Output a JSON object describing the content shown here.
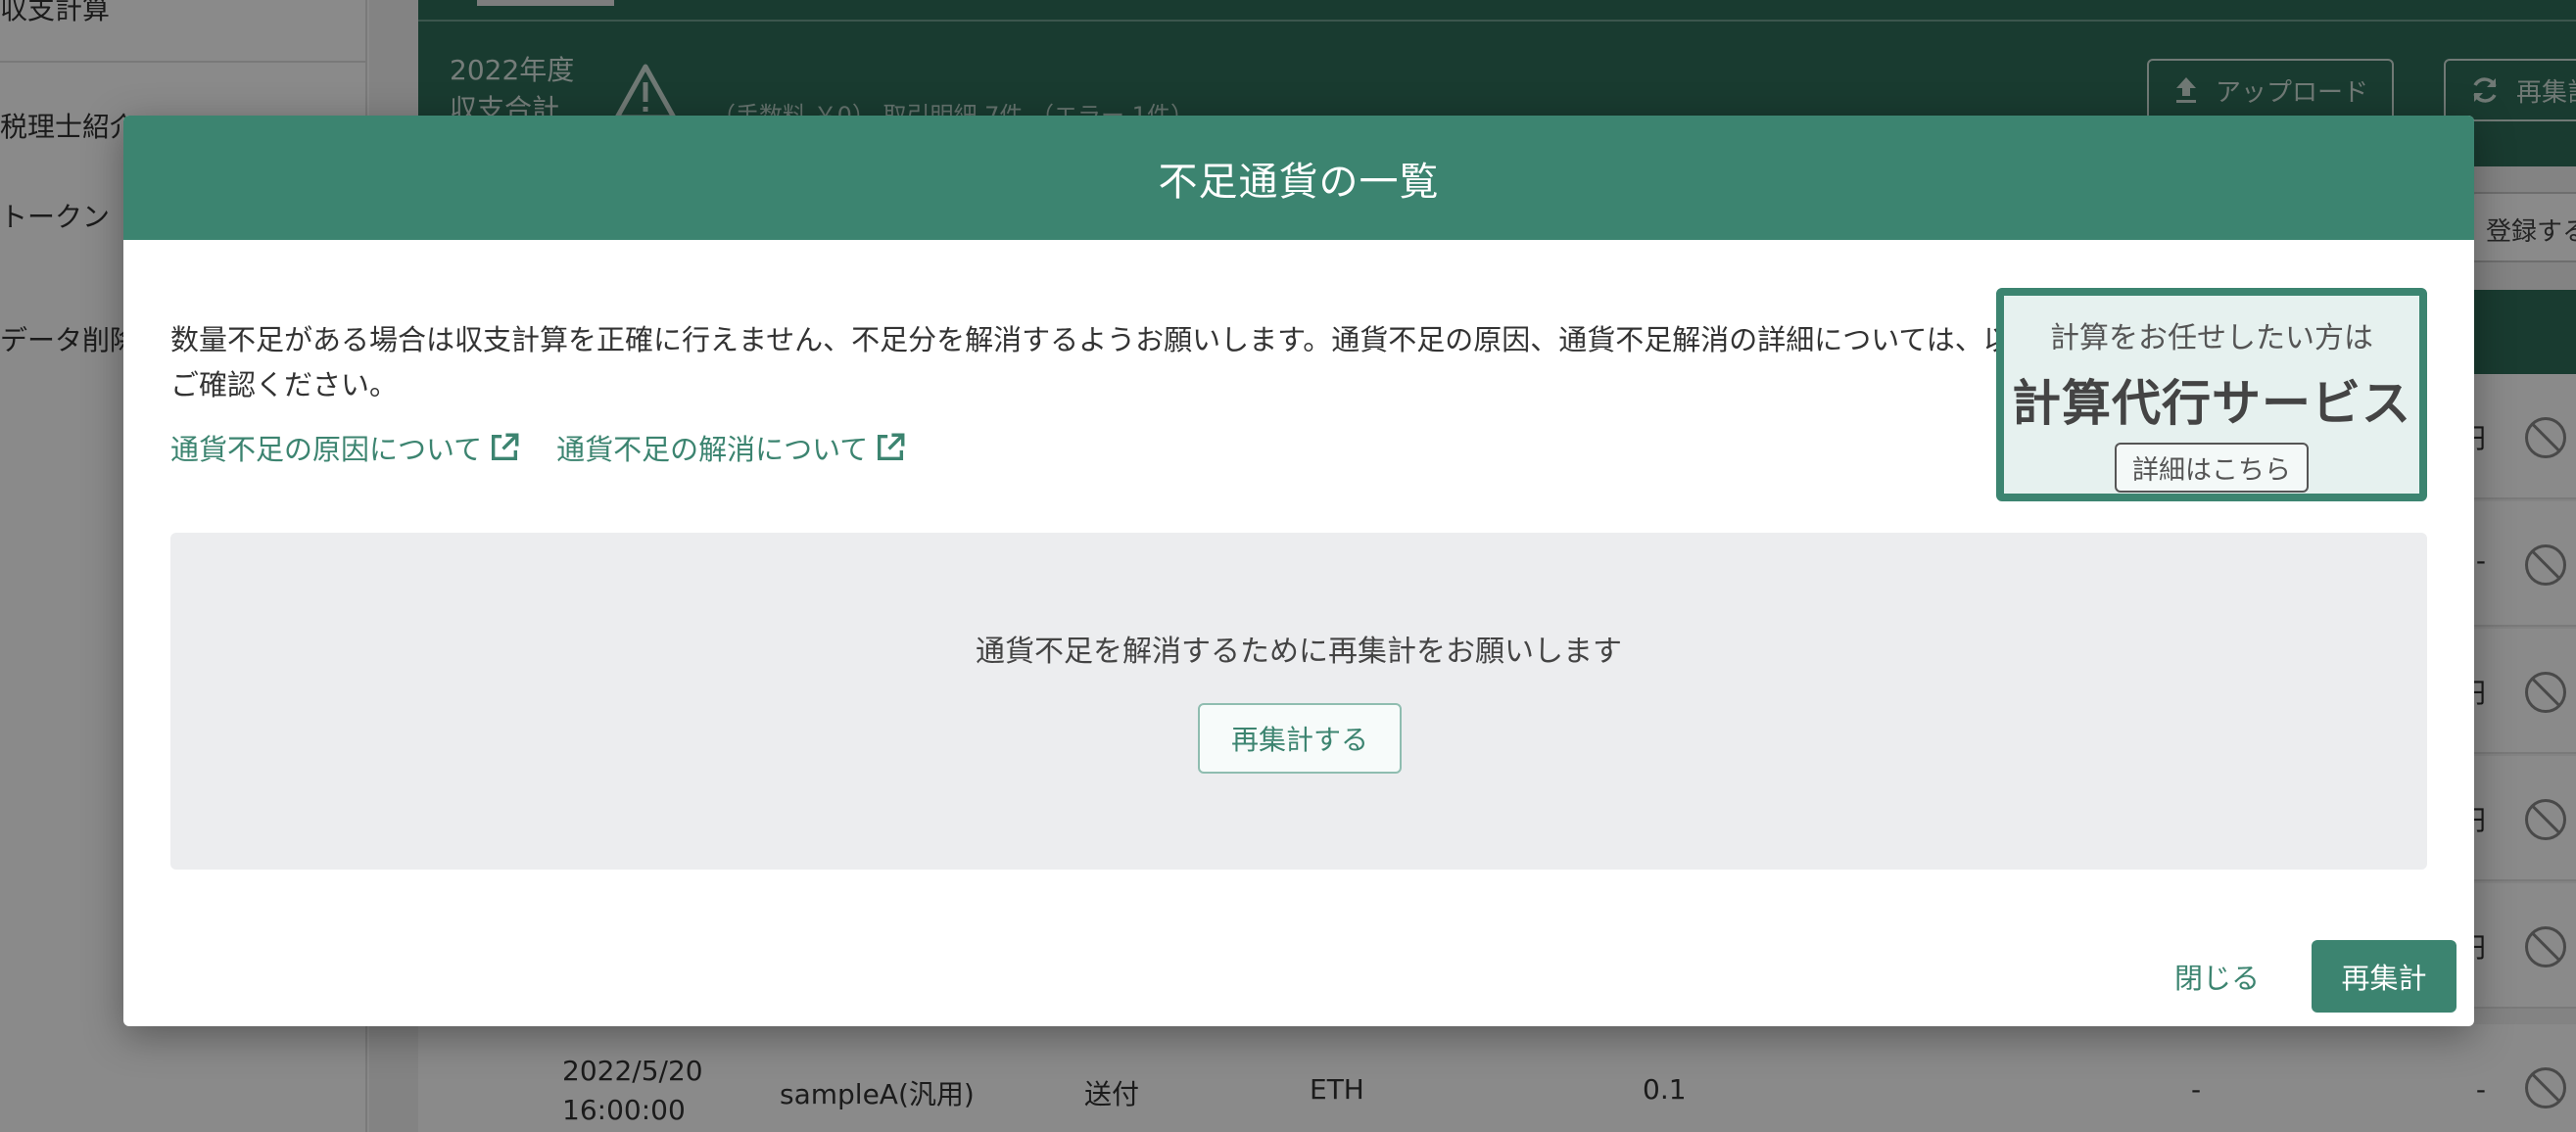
{
  "sidebar": {
    "items": [
      {
        "label": "収支計算"
      },
      {
        "label": "税理士紹介"
      },
      {
        "label": "トークン"
      },
      {
        "label": "データ削除"
      }
    ]
  },
  "topbar": {
    "year_label": "2022年度",
    "year_sub": "収支合計",
    "summary": "（手数料 ￥0）  取引明細 7件  （エラー 1件）",
    "upload_label": "アップロード",
    "recalc_label": "再集計"
  },
  "register_label": "登録する",
  "table_rows": [
    {
      "date": "",
      "time": "",
      "source": "",
      "type": "",
      "currency": "",
      "amount": "",
      "col1": "",
      "col2": "円"
    },
    {
      "date": "",
      "time": "",
      "source": "",
      "type": "",
      "currency": "",
      "amount": "",
      "col1": "",
      "col2": "-"
    },
    {
      "date": "",
      "time": "",
      "source": "",
      "type": "",
      "currency": "",
      "amount": "",
      "col1": "",
      "col2": "円"
    },
    {
      "date": "",
      "time": "",
      "source": "",
      "type": "",
      "currency": "",
      "amount": "",
      "col1": "",
      "col2": "円"
    },
    {
      "date": "",
      "time": "",
      "source": "",
      "type": "",
      "currency": "",
      "amount": "",
      "col1": "",
      "col2": "円"
    },
    {
      "date": "2022/5/20",
      "time": "16:00:00",
      "source": "sampleA(汎用)",
      "type": "送付",
      "currency": "ETH",
      "amount": "0.1",
      "col1": "-",
      "col2": "-"
    }
  ],
  "modal": {
    "title": "不足通貨の一覧",
    "description": "数量不足がある場合は収支計算を正確に行えません、不足分を解消するようお願いします。通貨不足の原因、通貨不足解消の詳細については、以下をご確認ください。",
    "links": [
      {
        "label": "通貨不足の原因について"
      },
      {
        "label": "通貨不足の解消について"
      }
    ],
    "service": {
      "subtitle": "計算をお任せしたい方は",
      "title": "計算代行サービス",
      "detail_label": "詳細はこちら"
    },
    "recalc_message": "通貨不足を解消するために再集計をお願いします",
    "recalc_button": "再集計する",
    "close_label": "閉じる",
    "primary_label": "再集計"
  },
  "colors": {
    "accent": "#3c8470",
    "header_dark": "#2f6e59"
  }
}
